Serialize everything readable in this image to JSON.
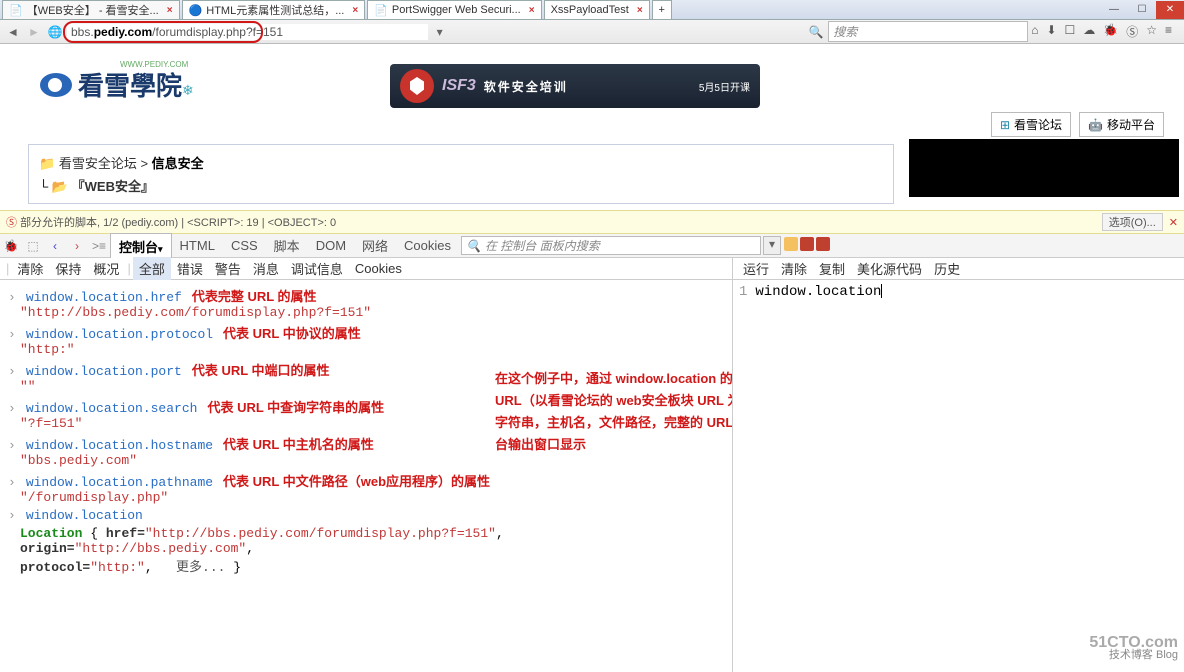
{
  "tabs": [
    {
      "label": "【WEB安全】 - 看雪安全...",
      "active": true
    },
    {
      "label": "HTML元素属性测试总结，..."
    },
    {
      "label": "PortSwigger Web Securi..."
    },
    {
      "label": "XssPayloadTest"
    }
  ],
  "url": {
    "prefix": "bbs.",
    "host": "pediy.com",
    "path": "/forumdisplay.php?f=151"
  },
  "search_placeholder": "搜索",
  "logo": {
    "text": "看雪學院",
    "sub": "WWW.PEDIY.COM"
  },
  "banner": {
    "brand": "ISF3",
    "text": "软件安全培训",
    "date": "5月5日开课"
  },
  "side_btns": {
    "win": "看雪论坛",
    "android": "移动平台"
  },
  "crumb": {
    "r1a": "看雪安全论坛",
    "r1b": "信息安全",
    "r2": "『WEB安全』"
  },
  "scriptbar": {
    "text": "部分允许的脚本, 1/2 (pediy.com) | <SCRIPT>: 19 | <OBJECT>: 0",
    "opt": "选项(O)..."
  },
  "fb": {
    "tabs": [
      "控制台",
      "HTML",
      "CSS",
      "脚本",
      "DOM",
      "网络",
      "Cookies"
    ],
    "search": "在 控制台 面板内搜索",
    "sub_left": [
      "清除",
      "保持",
      "概况",
      "全部",
      "错误",
      "警告",
      "消息",
      "调试信息",
      "Cookies"
    ],
    "sub_right": [
      "运行",
      "清除",
      "复制",
      "美化源代码",
      "历史"
    ]
  },
  "code": {
    "line": "1",
    "text": "window.location"
  },
  "entries": [
    {
      "cmd": "window.location.href",
      "ann": "代表完整 URL 的属性",
      "res": "\"http://bbs.pediy.com/forumdisplay.php?f=151\""
    },
    {
      "cmd": "window.location.protocol",
      "ann": "代表 URL 中协议的属性",
      "res": "\"http:\""
    },
    {
      "cmd": "window.location.port",
      "ann": "代表 URL 中端口的属性",
      "res": "\"\""
    },
    {
      "cmd": "window.location.search",
      "ann": "代表 URL 中查询字符串的属性",
      "res": "\"?f=151\""
    },
    {
      "cmd": "window.location.hostname",
      "ann": "代表 URL 中主机名的属性",
      "res": "\"bbs.pediy.com\""
    },
    {
      "cmd": "window.location.pathname",
      "ann": "代表 URL 中文件路径（web应用程序）的属性",
      "res": "\"/forumdisplay.php\""
    },
    {
      "cmd": "window.location",
      "ann": "",
      "res": ""
    }
  ],
  "location_obj": {
    "kw": "Location",
    "br": "{",
    "href_k": "href=",
    "href_v": "\"http://bbs.pediy.com/forumdisplay.php?f=151\"",
    "origin_k": "origin=",
    "origin_v": "\"http://bbs.pediy.com\"",
    "proto_k": "protocol=",
    "proto_v": "\"http:\"",
    "more": "更多...",
    "cb": "}"
  },
  "big_ann": "在这个例子中，通过 window.location 的各个成员属性的值，获取当前 URL（以看雪论坛的 web安全板块 URL 为例）中的协议，端口，查询字符串，主机名，文件路径，完整的 URL 等信息，并在 Firebug 控制台输出窗口显示",
  "watermark": {
    "big": "51CTO.com",
    "small": "技术博客    Blog"
  }
}
